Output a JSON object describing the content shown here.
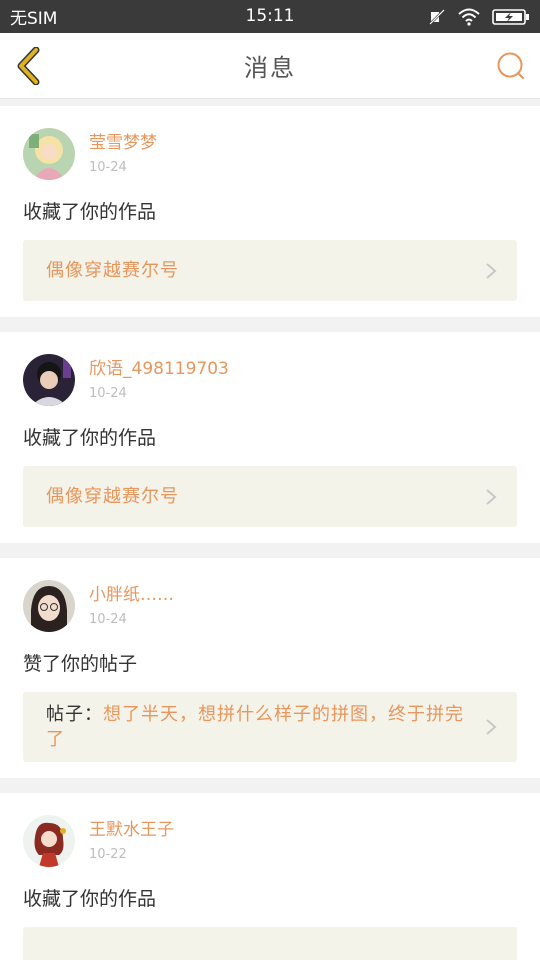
{
  "status_bar": {
    "carrier": "无SIM",
    "time": "15:11",
    "icons": [
      "mute-icon",
      "wifi-icon",
      "battery-charging-icon"
    ]
  },
  "header": {
    "title": "消息",
    "back_icon": "chevron-left-icon",
    "search_icon": "search-icon"
  },
  "colors": {
    "accent": "#e8965c",
    "back_icon": "#e0b21e",
    "card_target_bg": "#f3f3ea"
  },
  "messages": [
    {
      "username": "莹雪梦梦",
      "date": "10-24",
      "action": "收藏了你的作品",
      "target_prefix": "",
      "target": "偶像穿越赛尔号"
    },
    {
      "username": "欣语_498119703",
      "date": "10-24",
      "action": "收藏了你的作品",
      "target_prefix": "",
      "target": "偶像穿越赛尔号"
    },
    {
      "username": "小胖纸……",
      "date": "10-24",
      "action": "赞了你的帖子",
      "target_prefix": "帖子：",
      "target": "想了半天，想拼什么样子的拼图，终于拼完了"
    },
    {
      "username": "王默水王子",
      "date": "10-22",
      "action": "收藏了你的作品",
      "target_prefix": "",
      "target": ""
    }
  ]
}
